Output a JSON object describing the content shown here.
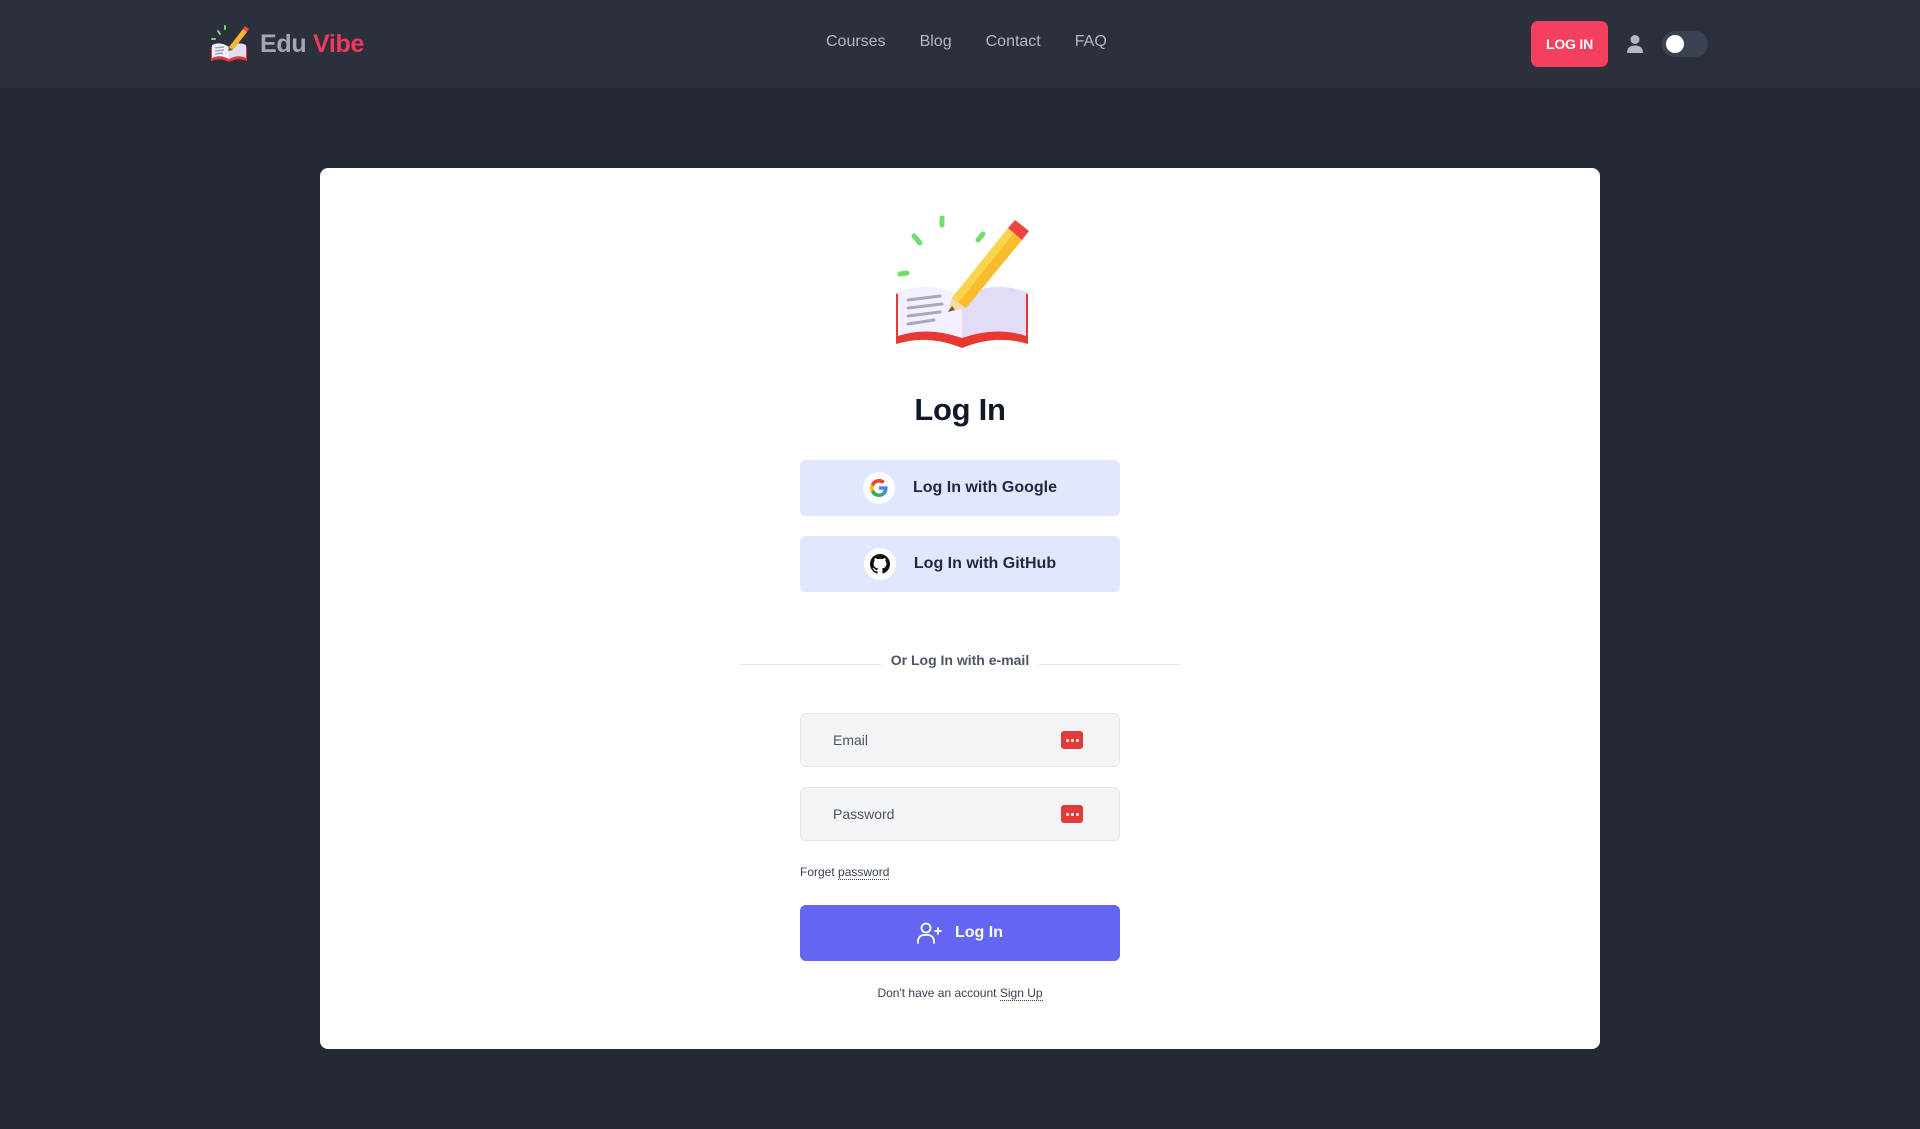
{
  "navbar": {
    "brand_part1": "Edu",
    "brand_part2": "Vibe",
    "links": [
      "Courses",
      "Blog",
      "Contact",
      "FAQ"
    ],
    "login_label": "LOG IN",
    "icons": {
      "user": "user-icon",
      "theme": "theme-toggle"
    }
  },
  "login": {
    "title": "Log In",
    "google_label": "Log In with Google",
    "github_label": "Log In with GitHub",
    "divider_text": "Or Log In with e-mail",
    "email_placeholder": "Email",
    "password_placeholder": "Password",
    "forget_prefix": "Forget",
    "forget_link": "password",
    "submit_label": "Log In",
    "signup_prefix": "Don't have an account",
    "signup_link": "Sign Up"
  },
  "colors": {
    "background": "#252935",
    "navbar": "#2b303c",
    "accent": "#f43f5e",
    "primary": "#6366f1",
    "oauth_bg": "#e0e7ff"
  }
}
